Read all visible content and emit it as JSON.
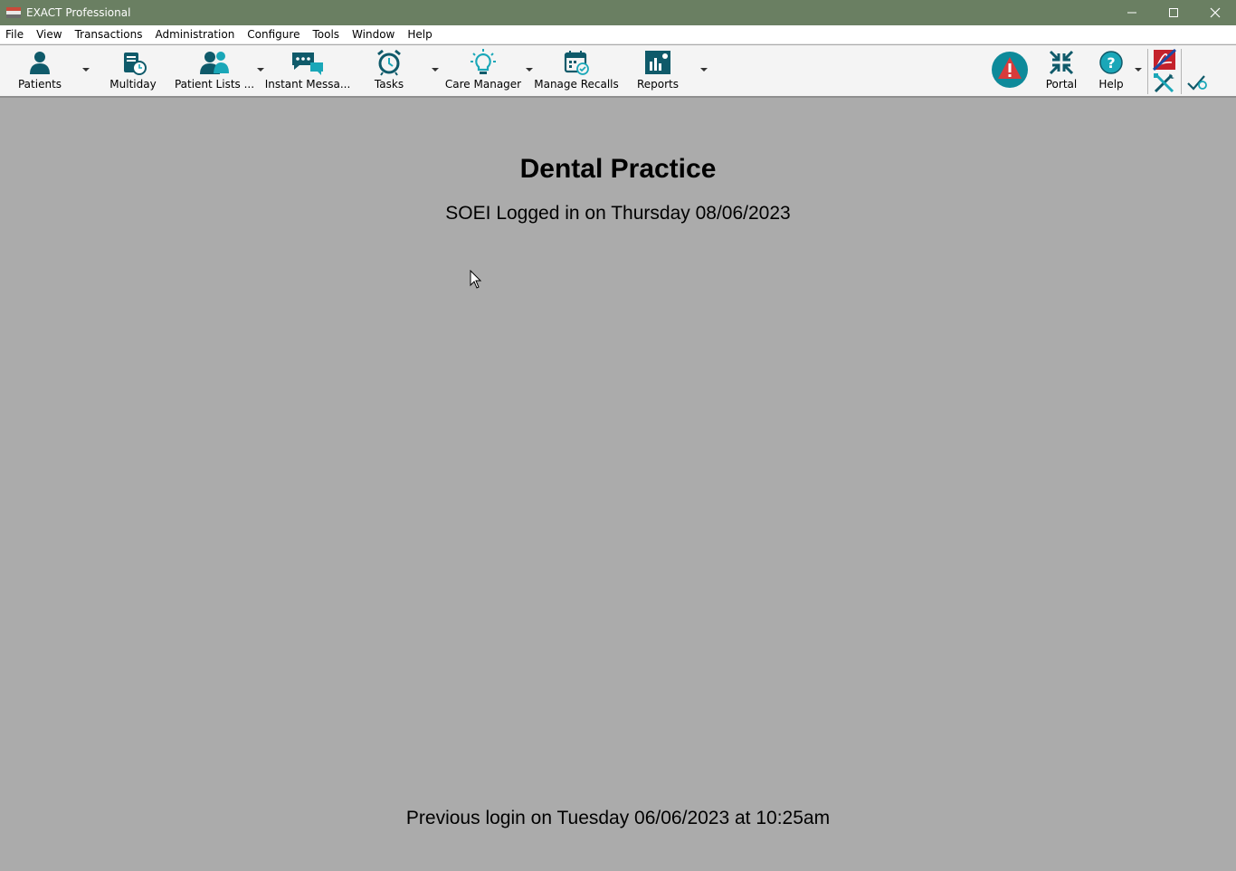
{
  "window": {
    "title": "EXACT Professional"
  },
  "menu": [
    "File",
    "View",
    "Transactions",
    "Administration",
    "Configure",
    "Tools",
    "Window",
    "Help"
  ],
  "toolbar": {
    "patients": "Patients",
    "multiday": "Multiday",
    "patient_lists": "Patient Lists ...",
    "instant_messages": "Instant Messa...",
    "tasks": "Tasks",
    "care_manager": "Care Manager",
    "manage_recalls": "Manage Recalls",
    "reports": "Reports",
    "portal": "Portal",
    "help": "Help"
  },
  "main": {
    "practice_name": "Dental Practice",
    "login_text": "SOEI Logged in on Thursday 08/06/2023",
    "previous_login": "Previous login on Tuesday 06/06/2023 at 10:25am"
  },
  "colors": {
    "titlebar": "#6a7f62",
    "icon_teal": "#0f5a6a",
    "icon_light_teal": "#1aa7b8",
    "alert_red": "#d83b3b",
    "background": "#ababab"
  }
}
